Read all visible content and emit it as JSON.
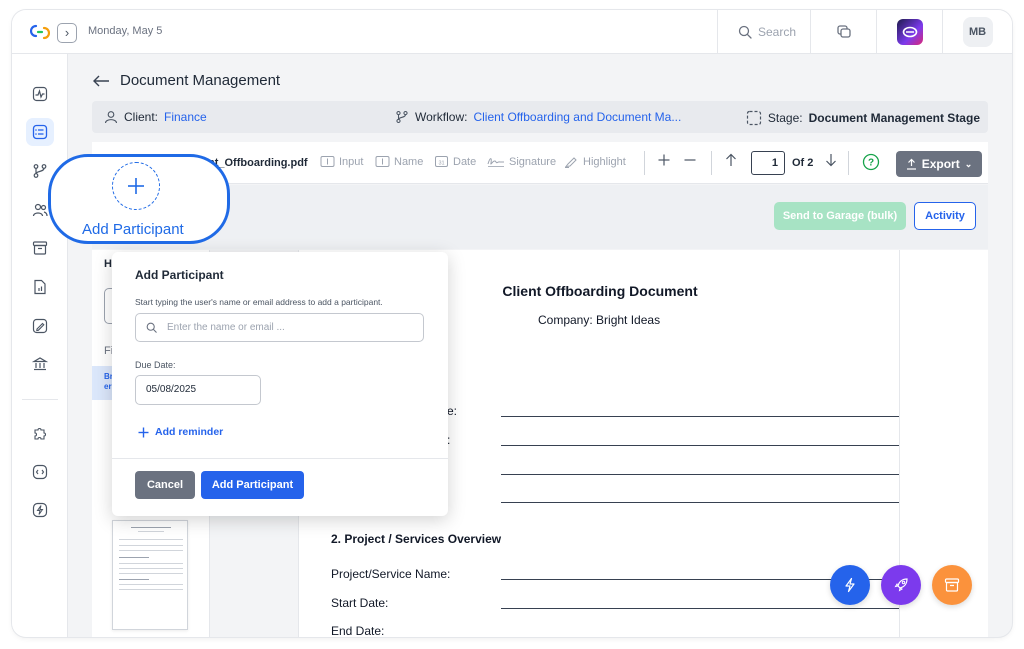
{
  "topbar": {
    "date": "Monday, May 5",
    "search_label": "Search",
    "avatar_initials": "MB"
  },
  "header": {
    "title": "Document Management"
  },
  "infobar": {
    "client_label": "Client:",
    "client_value": "Finance",
    "workflow_label": "Workflow:",
    "workflow_value": "Client Offboarding and Document Ma...",
    "stage_label": "Stage:",
    "stage_value": "Document Management Stage"
  },
  "toolbar": {
    "filename": "nt_Offboarding.pdf",
    "tools": [
      "Input",
      "Name",
      "Date",
      "Signature",
      "Highlight"
    ],
    "page_current": "1",
    "page_of": "Of 2",
    "export_label": "Export"
  },
  "actions": {
    "send_label": "Send to Garage (bulk)",
    "activity_label": "Activity"
  },
  "left_panel": {
    "heading": "H",
    "f_label": "Fi",
    "selected_line1": "Br",
    "selected_line2": "er"
  },
  "document": {
    "title": "Client Offboarding Document",
    "company": "Company: Bright Ideas",
    "frag1": "e:",
    "frag2": ":",
    "section": "2. Project / Services Overview",
    "fields": [
      "Project/Service Name:",
      "Start Date:",
      "End Date:"
    ]
  },
  "popup": {
    "title": "Add Participant",
    "help": "Start typing the user's name or email address to add a participant.",
    "search_placeholder": "Enter the name or email ...",
    "due_label": "Due Date:",
    "due_value": "05/08/2025",
    "reminder_label": "Add reminder",
    "cancel_label": "Cancel",
    "add_label": "Add Participant"
  },
  "callout": {
    "label": "Add Participant"
  },
  "colors": {
    "accent": "#2563eb",
    "callout": "#1f6ae6",
    "fab_blue": "#2563eb",
    "fab_purple": "#7c3aed",
    "fab_orange": "#fb923c"
  }
}
